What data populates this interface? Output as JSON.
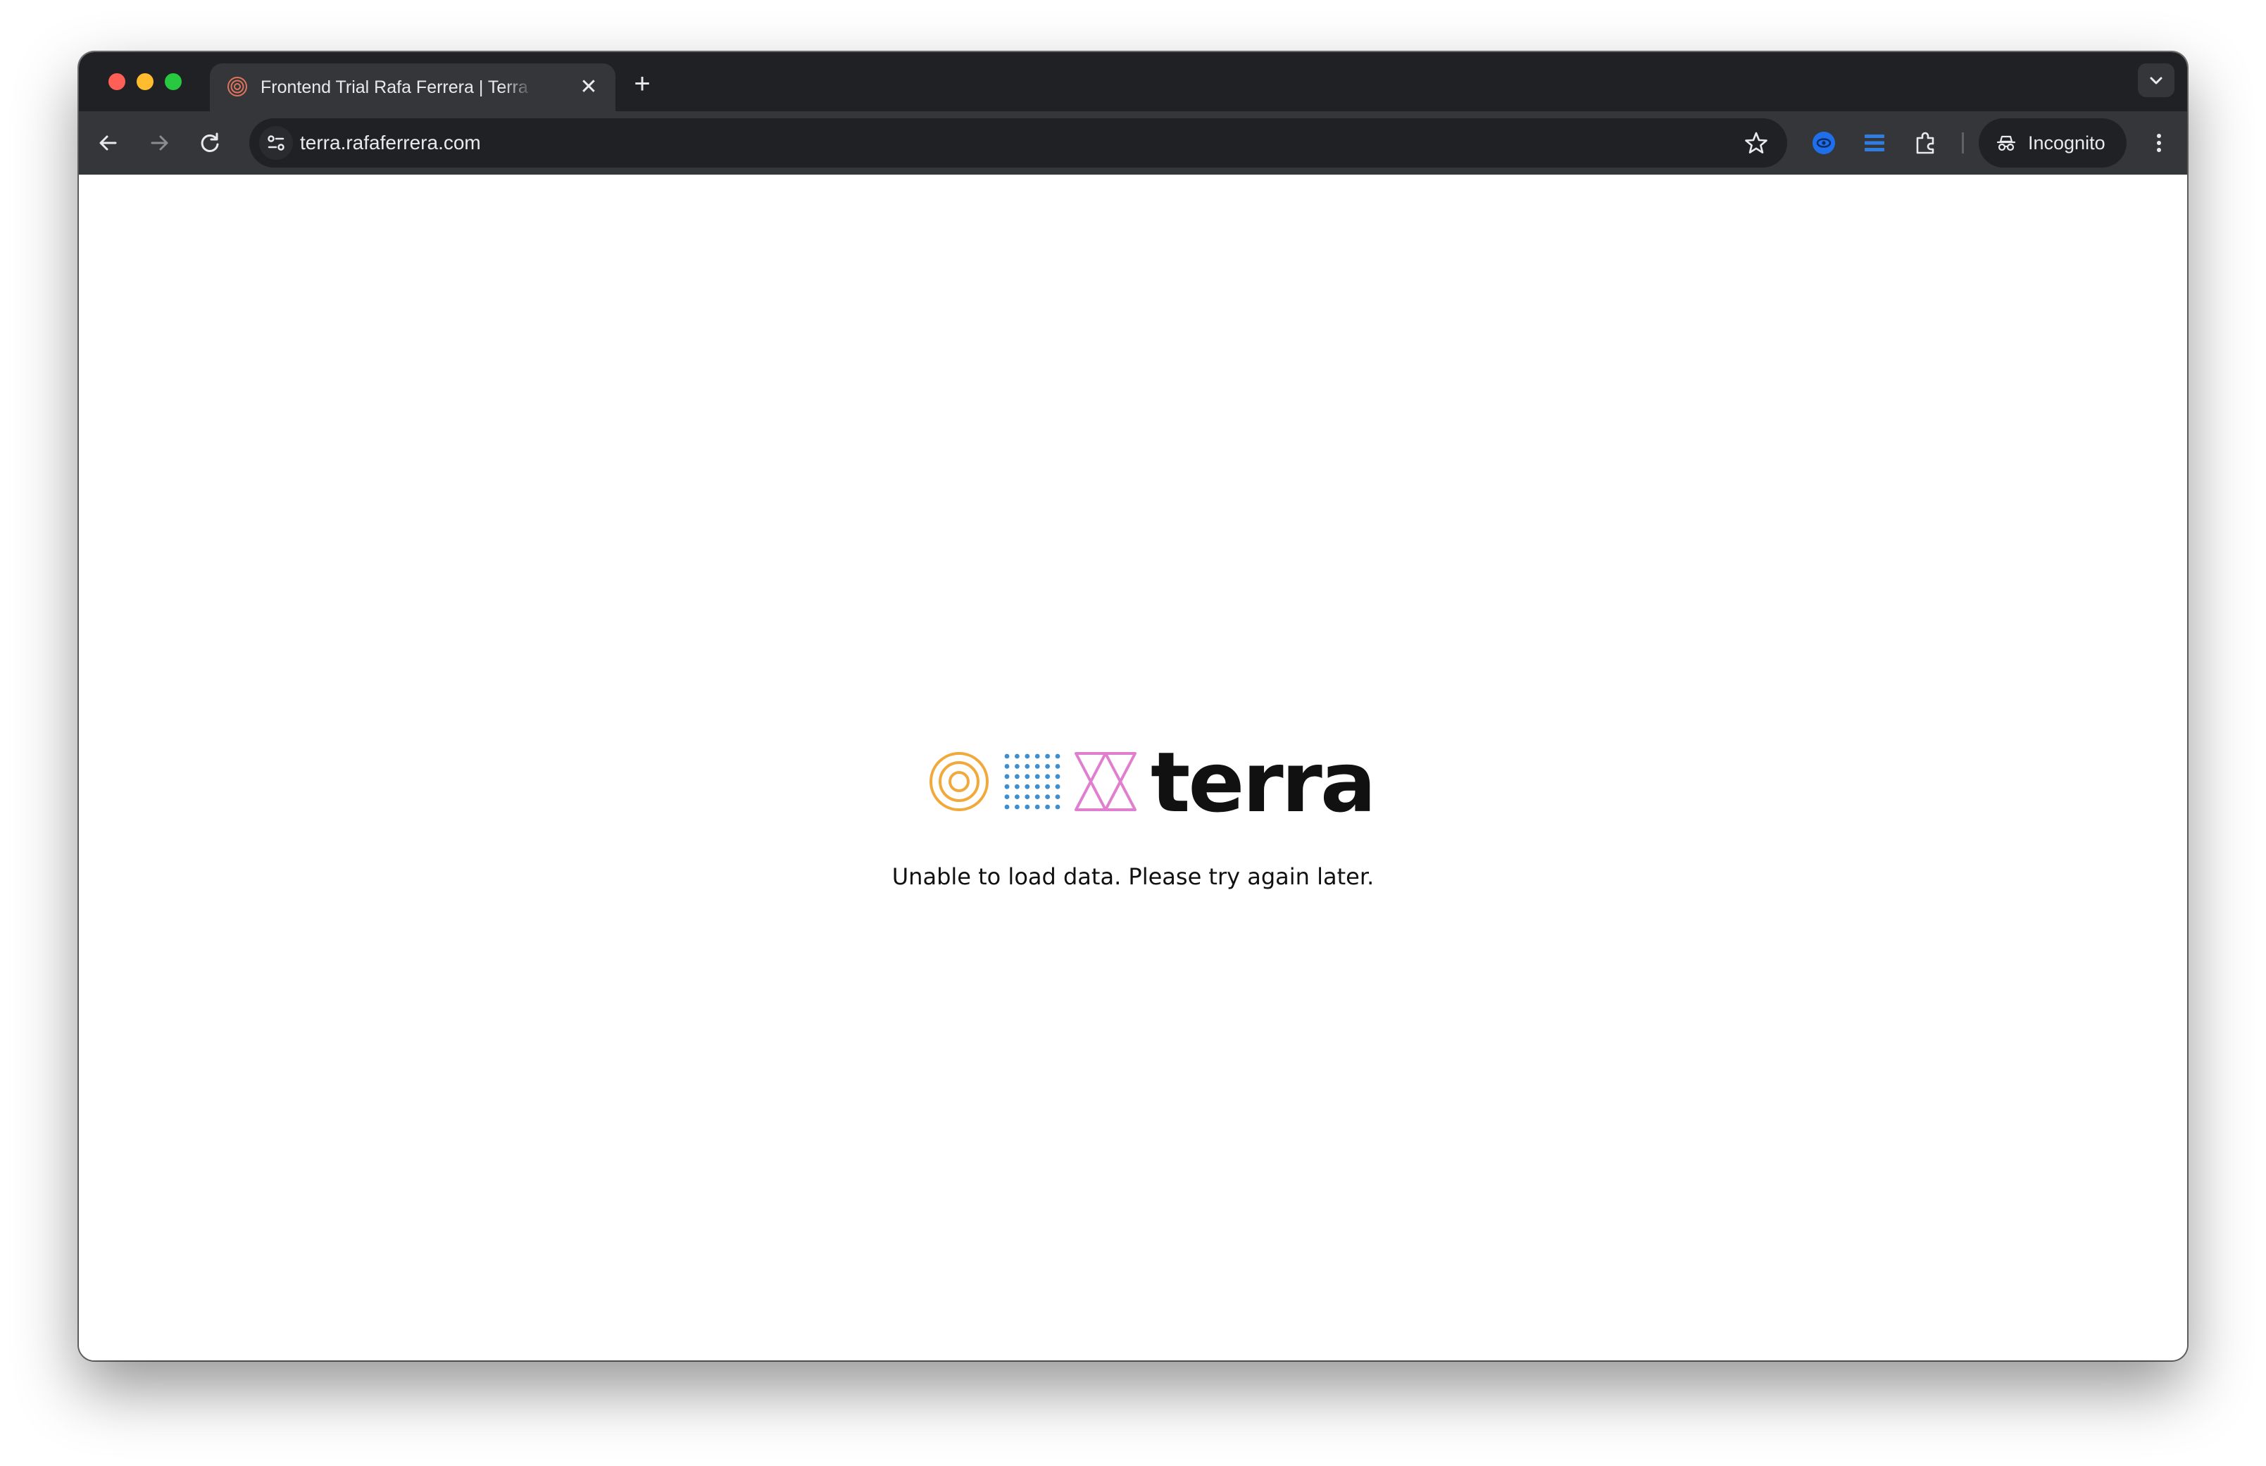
{
  "browser": {
    "tab": {
      "title": "Frontend Trial Rafa Ferrera | Terra",
      "favicon": "terra-target-icon"
    },
    "new_tab_label": "+",
    "close_tab_label": "✕",
    "address_bar": {
      "url": "terra.rafaferrera.com"
    },
    "profile": {
      "label": "Incognito"
    },
    "colors": {
      "frame": "#202124",
      "toolbar": "#35363a",
      "text": "#e8eaed"
    }
  },
  "page": {
    "logo": {
      "wordmark": "terra",
      "colors": {
        "circles": "#f2a93b",
        "dots": "#3f8fcf",
        "hourglass": "#e07fd0"
      }
    },
    "message": "Unable to load data. Please try again later."
  }
}
